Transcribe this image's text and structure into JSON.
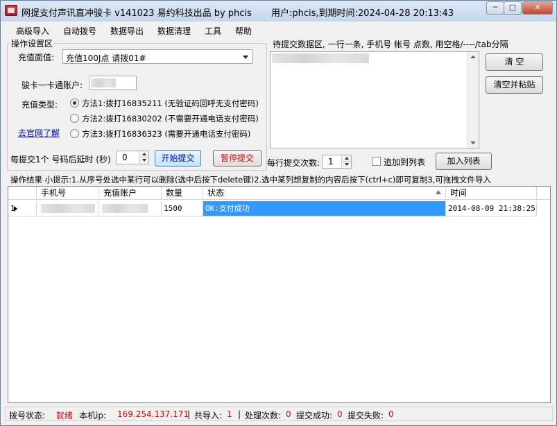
{
  "window": {
    "title": "网提支付声讯直冲骏卡  v141023   易约科技出品  by phcis",
    "user_info": "用户:phcis,到期时间:2024-04-28 20:13:43",
    "min_label": "─",
    "max_label": "□",
    "close_label": "✕"
  },
  "menu": [
    "高级导入",
    "自动拨号",
    "数据导出",
    "数据清理",
    "工具",
    "帮助"
  ],
  "settings": {
    "group_title": "操作设置区",
    "face_value_label": "充值面值:",
    "face_value_selected": "充值100J点 请拨01#",
    "account_label": "骏卡一卡通账户:",
    "type_label": "充值类型:",
    "methods": [
      {
        "label": "方法1:拨打16835211 (无验证码回呼无支付密码)",
        "checked": true
      },
      {
        "label": "方法2:拨打16830202 (不需要开通电话支付密码)",
        "checked": false
      },
      {
        "label": "方法3:拨打16836323 (需要开通电话支付密码)",
        "checked": false
      }
    ],
    "official_link": "去官网了解",
    "delay_label": "每提交1个 号码后延时 (秒)",
    "delay_value": "0",
    "start_button": "开始提交",
    "pause_button": "暂停提交"
  },
  "pending": {
    "title": "待提交数据区, 一行一条, 手机号 帐号 点数, 用空格/----/tab分隔",
    "clear_button": "清  空",
    "clear_paste_button": "清空并粘贴",
    "times_label": "每行提交次数:",
    "times_value": "1",
    "append_label": "追加到列表",
    "add_button": "加入列表"
  },
  "results": {
    "hint": "操作结果 小提示:1.从序号处选中某行可以删除(选中后按下delete键)2.选中某列想复制的内容后按下(ctrl+c)即可复制3,可拖拽文件导入",
    "columns": [
      "手机号",
      "充值账户",
      "数量",
      "状态",
      "时间"
    ],
    "rows": [
      {
        "index": "1",
        "phone": "",
        "account": "",
        "amount": "1500",
        "status": "OK:支付成功",
        "time": "2014-08-09 21:38:25"
      }
    ]
  },
  "status": {
    "dial_label": "拨号状态:",
    "dial_value": "就绪",
    "ip_label": "本机ip:",
    "ip_value": "169.254.137.171",
    "imported_label": "共导入:",
    "imported_value": "1",
    "processed_label": "处理次数:",
    "processed_value": "0",
    "success_label": "提交成功:",
    "success_value": "0",
    "fail_label": "提交失败:",
    "fail_value": "0",
    "separator": "|"
  },
  "colors": {
    "accent_red": "#e00000",
    "selection": "#3399ff",
    "link": "#0000ee"
  }
}
